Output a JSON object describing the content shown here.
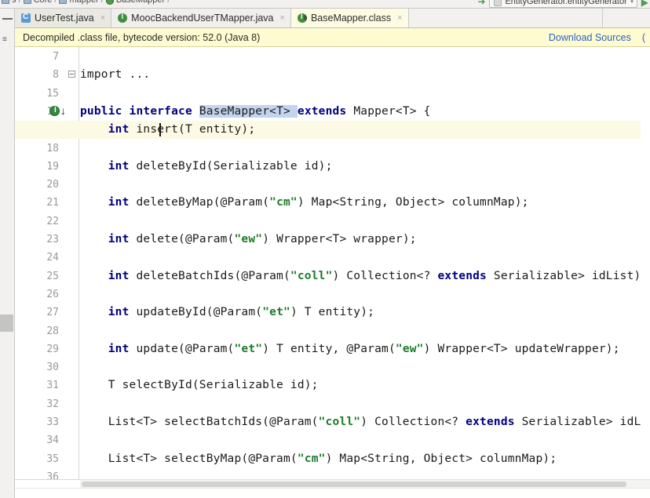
{
  "breadcrumb": {
    "items": [
      {
        "label": "s",
        "icon": "folder-icon"
      },
      {
        "label": "Core",
        "icon": "folder-icon"
      },
      {
        "label": "mapper",
        "icon": "folder-icon"
      },
      {
        "label": "BaseMapper",
        "icon": "class-icon"
      }
    ],
    "separator": "/",
    "run_config": "EntityGenerator.entityGenerator",
    "run_caret": "▾",
    "run_button": "▶"
  },
  "tabs": [
    {
      "label": "UserTest.java",
      "icon": "java-class-icon",
      "close": "×",
      "active": false
    },
    {
      "label": "MoocBackendUserTMapper.java",
      "icon": "java-interface-icon",
      "close": "×",
      "active": false
    },
    {
      "label": "BaseMapper.class",
      "icon": "decompiled-class-icon",
      "close": "×",
      "active": true
    }
  ],
  "banner": {
    "message": "Decompiled .class file, bytecode version: 52.0 (Java 8)",
    "link": "Download Sources",
    "extra": "("
  },
  "editor": {
    "language": "java",
    "file": "BaseMapper.class",
    "cursor_line": 17,
    "selection": "BaseMapper",
    "gutter_markers": [
      {
        "line": 8,
        "type": "fold-collapsed-icon"
      },
      {
        "line": 16,
        "type": "implemented-interface-icon"
      }
    ],
    "lines": [
      {
        "num": "7",
        "tokens": []
      },
      {
        "num": "8",
        "indent": 1,
        "tokens": [
          {
            "t": "import ...",
            "c": "kw-plain"
          }
        ]
      },
      {
        "num": "15",
        "tokens": []
      },
      {
        "num": "16",
        "tokens": [
          {
            "t": "public",
            "c": "kw"
          },
          {
            "t": " ",
            "c": "p"
          },
          {
            "t": "interface",
            "c": "kw"
          },
          {
            "t": " ",
            "c": "p"
          },
          {
            "t": "BaseMapper",
            "c": "sel"
          },
          {
            "t": "<T> ",
            "c": "sel"
          },
          {
            "t": "extends",
            "c": "kw"
          },
          {
            "t": " Mapper<T> {",
            "c": "p"
          }
        ]
      },
      {
        "num": "17",
        "tokens": [
          {
            "t": "    ",
            "c": "p"
          },
          {
            "t": "int",
            "c": "kw"
          },
          {
            "t": " insert(T entity);",
            "c": "p"
          }
        ]
      },
      {
        "num": "18",
        "tokens": []
      },
      {
        "num": "19",
        "tokens": [
          {
            "t": "    ",
            "c": "p"
          },
          {
            "t": "int",
            "c": "kw"
          },
          {
            "t": " deleteById(Serializable id);",
            "c": "p"
          }
        ]
      },
      {
        "num": "20",
        "tokens": []
      },
      {
        "num": "21",
        "tokens": [
          {
            "t": "    ",
            "c": "p"
          },
          {
            "t": "int",
            "c": "kw"
          },
          {
            "t": " deleteByMap(@Param(",
            "c": "p"
          },
          {
            "t": "\"cm\"",
            "c": "str"
          },
          {
            "t": ") Map<String, Object> columnMap);",
            "c": "p"
          }
        ]
      },
      {
        "num": "22",
        "tokens": []
      },
      {
        "num": "23",
        "tokens": [
          {
            "t": "    ",
            "c": "p"
          },
          {
            "t": "int",
            "c": "kw"
          },
          {
            "t": " delete(@Param(",
            "c": "p"
          },
          {
            "t": "\"ew\"",
            "c": "str"
          },
          {
            "t": ") Wrapper<T> wrapper);",
            "c": "p"
          }
        ]
      },
      {
        "num": "24",
        "tokens": []
      },
      {
        "num": "25",
        "tokens": [
          {
            "t": "    ",
            "c": "p"
          },
          {
            "t": "int",
            "c": "kw"
          },
          {
            "t": " deleteBatchIds(@Param(",
            "c": "p"
          },
          {
            "t": "\"coll\"",
            "c": "str"
          },
          {
            "t": ") Collection<? ",
            "c": "p"
          },
          {
            "t": "extends",
            "c": "kw"
          },
          {
            "t": " Serializable> idList);",
            "c": "p"
          }
        ]
      },
      {
        "num": "26",
        "tokens": []
      },
      {
        "num": "27",
        "tokens": [
          {
            "t": "    ",
            "c": "p"
          },
          {
            "t": "int",
            "c": "kw"
          },
          {
            "t": " updateById(@Param(",
            "c": "p"
          },
          {
            "t": "\"et\"",
            "c": "str"
          },
          {
            "t": ") T entity);",
            "c": "p"
          }
        ]
      },
      {
        "num": "28",
        "tokens": []
      },
      {
        "num": "29",
        "tokens": [
          {
            "t": "    ",
            "c": "p"
          },
          {
            "t": "int",
            "c": "kw"
          },
          {
            "t": " update(@Param(",
            "c": "p"
          },
          {
            "t": "\"et\"",
            "c": "str"
          },
          {
            "t": ") T entity, @Param(",
            "c": "p"
          },
          {
            "t": "\"ew\"",
            "c": "str"
          },
          {
            "t": ") Wrapper<T> updateWrapper);",
            "c": "p"
          }
        ]
      },
      {
        "num": "30",
        "tokens": []
      },
      {
        "num": "31",
        "tokens": [
          {
            "t": "    T selectById(Serializable id);",
            "c": "p"
          }
        ]
      },
      {
        "num": "32",
        "tokens": []
      },
      {
        "num": "33",
        "tokens": [
          {
            "t": "    List<T> selectBatchIds(@Param(",
            "c": "p"
          },
          {
            "t": "\"coll\"",
            "c": "str"
          },
          {
            "t": ") Collection<? ",
            "c": "p"
          },
          {
            "t": "extends",
            "c": "kw"
          },
          {
            "t": " Serializable> idList);",
            "c": "p"
          }
        ]
      },
      {
        "num": "34",
        "tokens": []
      },
      {
        "num": "35",
        "tokens": [
          {
            "t": "    List<T> selectByMap(@Param(",
            "c": "p"
          },
          {
            "t": "\"cm\"",
            "c": "str"
          },
          {
            "t": ") Map<String, Object> columnMap);",
            "c": "p"
          }
        ]
      },
      {
        "num": "36",
        "tokens": []
      }
    ]
  },
  "colors": {
    "banner_bg": "#fdfbcf",
    "link": "#2b60c6",
    "keyword": "#000080",
    "string": "#1c7a28",
    "selection": "#c3d4ef",
    "current_line": "#fcfae4",
    "interface_icon": "#2f8b3e"
  }
}
